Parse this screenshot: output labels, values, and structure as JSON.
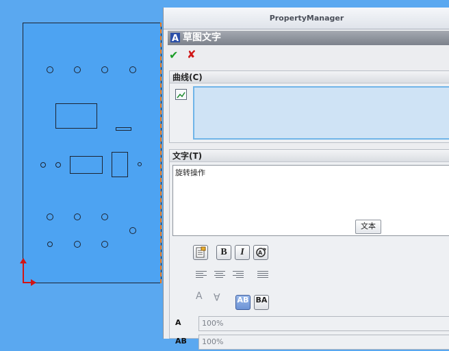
{
  "panel_title": "PropertyManager",
  "feature_title": "草图文字",
  "ok_symbol": "✔",
  "cancel_symbol": "✘",
  "curves_group": {
    "title": "曲线(C)"
  },
  "text_group": {
    "title": "文字(T)",
    "value": "旋转操作",
    "tag": "文本"
  },
  "format": {
    "bold": "B",
    "italic": "I",
    "flip_ab": "AB",
    "flip_ba": "BA",
    "width_factor": "100%",
    "spacing": "100%"
  },
  "colors": {
    "viewport_bg": "#5aa8f0",
    "axis": "#d21414",
    "dashed": "#f07a18"
  }
}
